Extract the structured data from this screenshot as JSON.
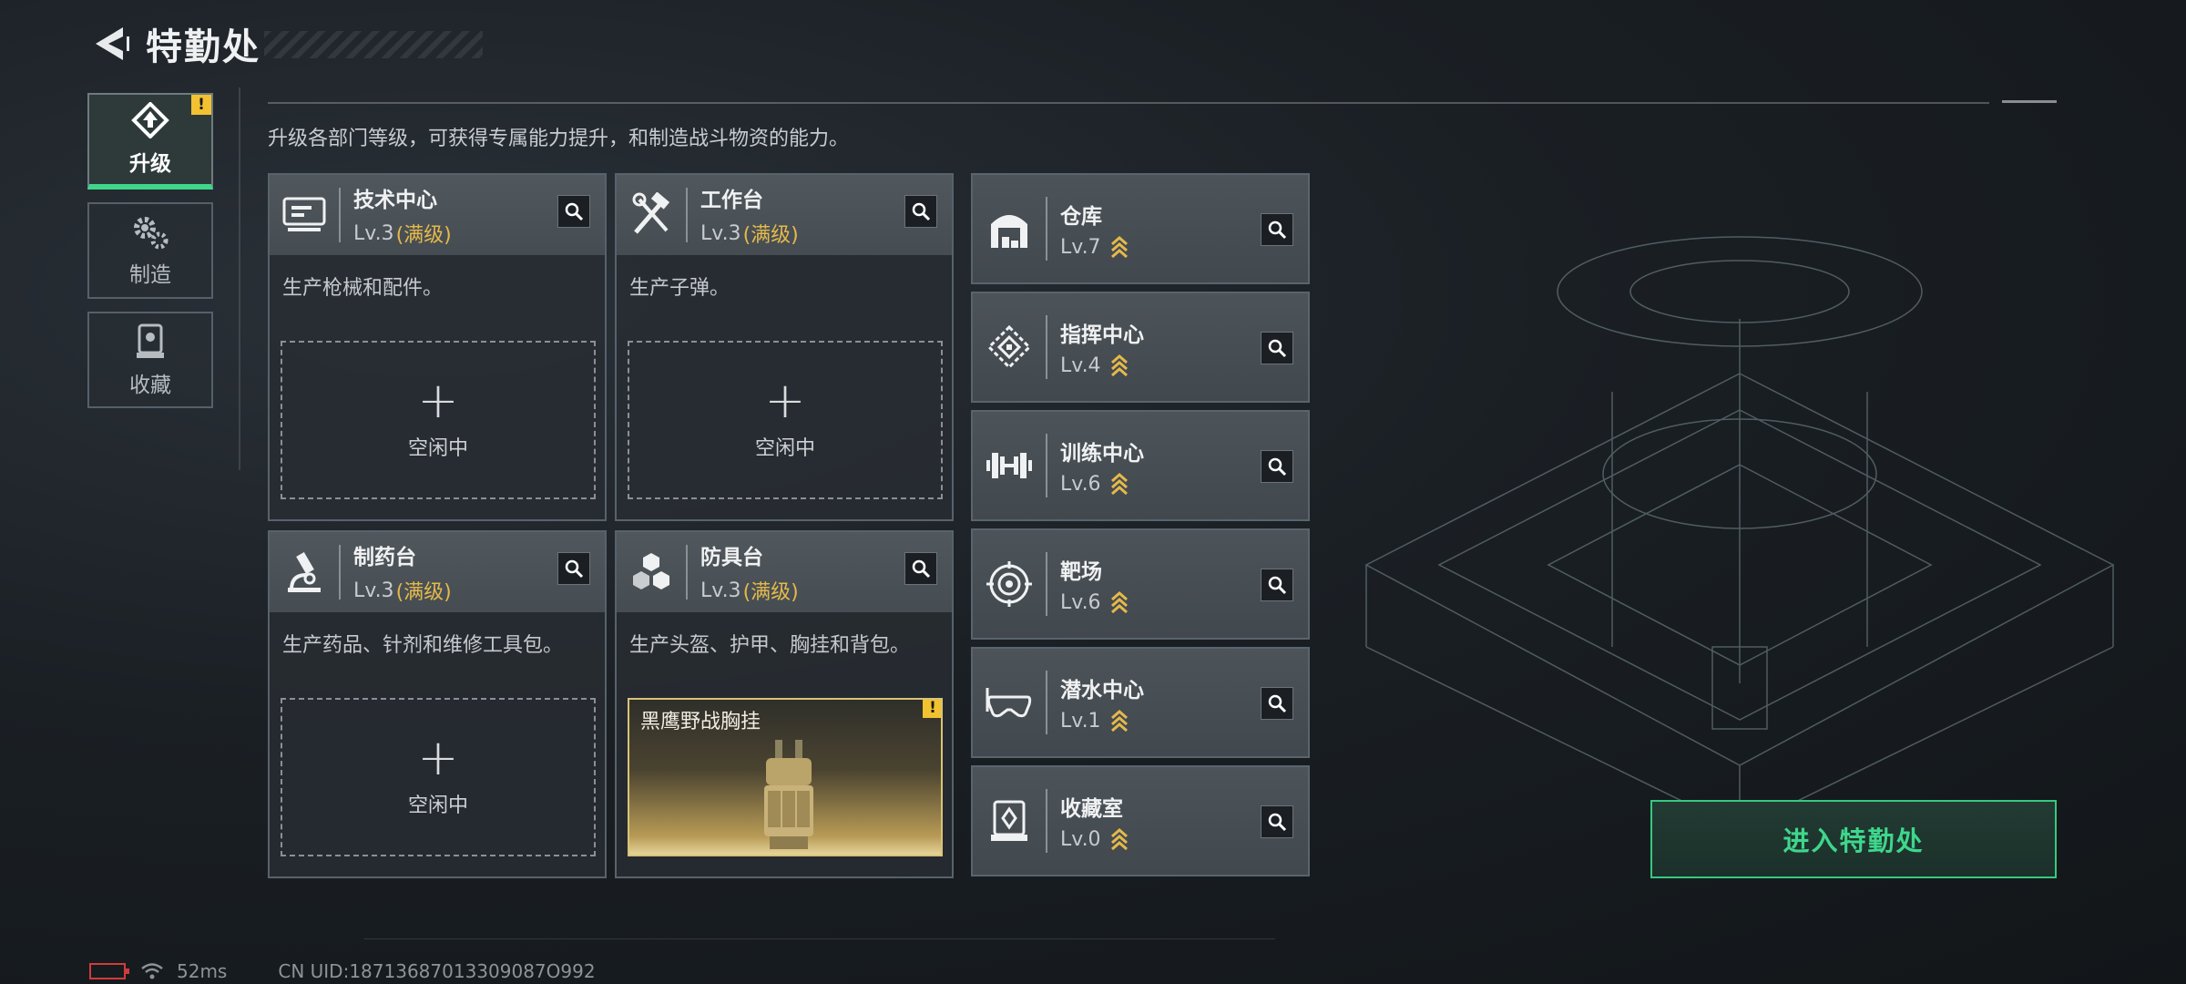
{
  "header": {
    "title": "特勤处",
    "back_icon": "back-arrow-icon"
  },
  "sidebar": {
    "tabs": [
      {
        "label": "升级",
        "icon": "upgrade-icon",
        "active": true,
        "warning": "!"
      },
      {
        "label": "制造",
        "icon": "gears-icon",
        "active": false
      },
      {
        "label": "收藏",
        "icon": "collection-icon",
        "active": false
      }
    ]
  },
  "description": "升级各部门等级，可获得专属能力提升，和制造战斗物资的能力。",
  "workbenches": [
    {
      "name": "技术中心",
      "level": "Lv.3",
      "max_label": "(满级)",
      "desc": "生产枪械和配件。",
      "icon": "monitor-icon",
      "slot": {
        "type": "idle",
        "plus": "+",
        "text": "空闲中"
      }
    },
    {
      "name": "工作台",
      "level": "Lv.3",
      "max_label": "(满级)",
      "desc": "生产子弹。",
      "icon": "tools-icon",
      "slot": {
        "type": "idle",
        "plus": "+",
        "text": "空闲中"
      }
    },
    {
      "name": "制药台",
      "level": "Lv.3",
      "max_label": "(满级)",
      "desc": "生产药品、针剂和维修工具包。",
      "icon": "microscope-icon",
      "slot": {
        "type": "idle",
        "plus": "+",
        "text": "空闲中"
      }
    },
    {
      "name": "防具台",
      "level": "Lv.3",
      "max_label": "(满级)",
      "desc": "生产头盔、护甲、胸挂和背包。",
      "icon": "armor-cubes-icon",
      "slot": {
        "type": "item",
        "item_name": "黑鹰野战胸挂",
        "warning": "!"
      }
    }
  ],
  "facilities": [
    {
      "name": "仓库",
      "level": "Lv.7",
      "icon": "warehouse-icon"
    },
    {
      "name": "指挥中心",
      "level": "Lv.4",
      "icon": "command-icon"
    },
    {
      "name": "训练中心",
      "level": "Lv.6",
      "icon": "dumbbell-icon"
    },
    {
      "name": "靶场",
      "level": "Lv.6",
      "icon": "target-icon"
    },
    {
      "name": "潜水中心",
      "level": "Lv.1",
      "icon": "dive-mask-icon"
    },
    {
      "name": "收藏室",
      "level": "Lv.0",
      "icon": "display-case-icon"
    }
  ],
  "enter_button": "进入特勤处",
  "status": {
    "ping": "52ms",
    "uid": "CN UID:18713687013309087O992"
  },
  "colors": {
    "accent_green": "#3fd68c",
    "max_gold": "#e5b94a",
    "warning_yellow": "#f2c230"
  }
}
